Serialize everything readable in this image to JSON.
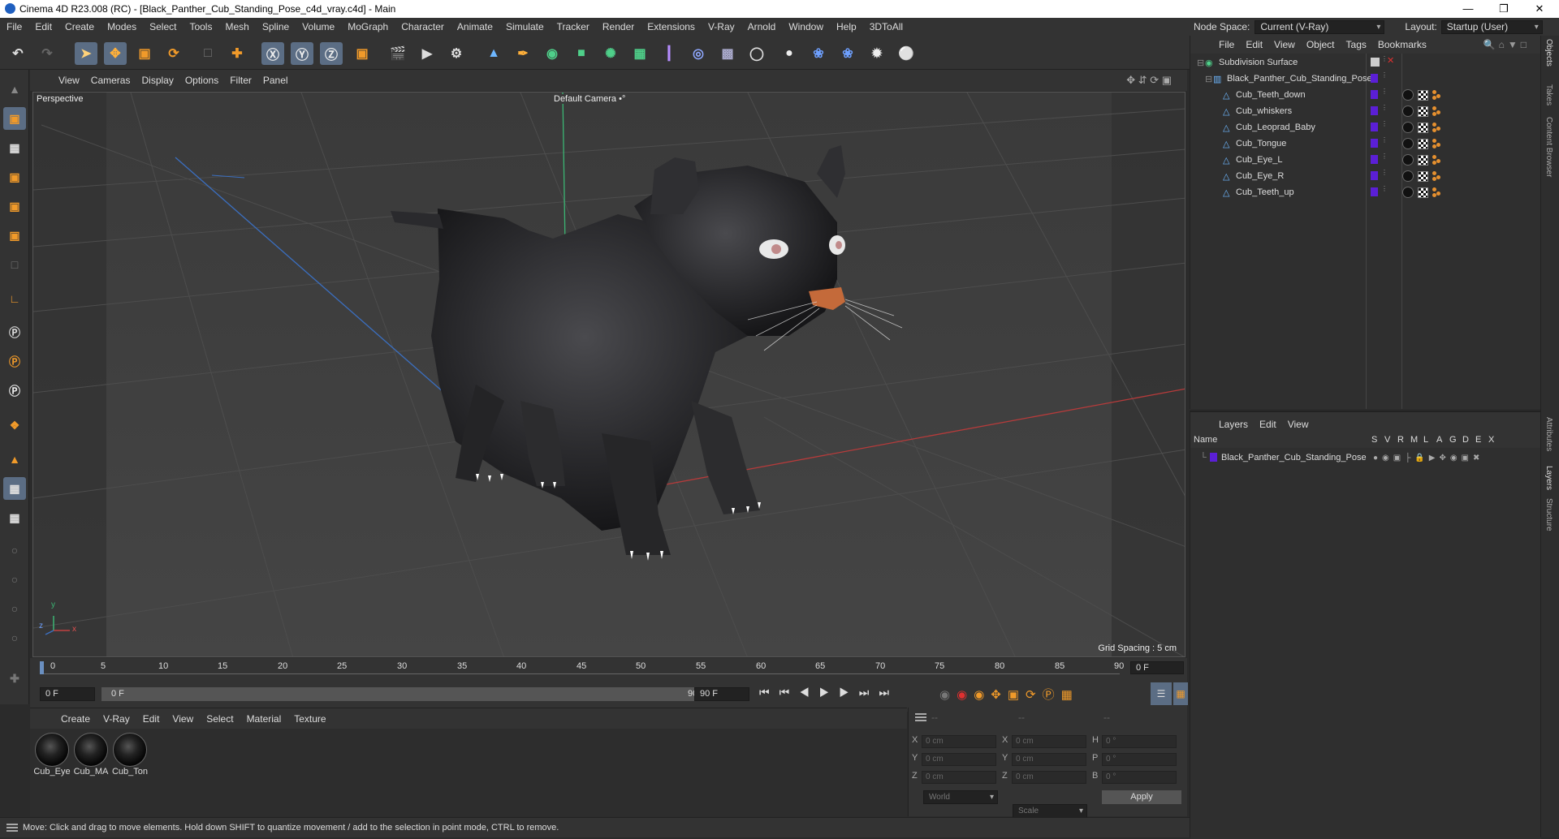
{
  "window": {
    "title": "Cinema 4D R23.008 (RC) - [Black_Panther_Cub_Standing_Pose_c4d_vray.c4d] - Main",
    "minimize": "—",
    "maximize": "❐",
    "close": "✕"
  },
  "menu": [
    "File",
    "Edit",
    "Create",
    "Modes",
    "Select",
    "Tools",
    "Mesh",
    "Spline",
    "Volume",
    "MoGraph",
    "Character",
    "Animate",
    "Simulate",
    "Tracker",
    "Render",
    "Extensions",
    "V-Ray",
    "Arnold",
    "Window",
    "Help",
    "3DToAll"
  ],
  "nodespace": {
    "label": "Node Space:",
    "value": "Current (V-Ray)",
    "layout_label": "Layout:",
    "layout_value": "Startup (User)"
  },
  "viewport": {
    "menu": [
      "View",
      "Cameras",
      "Display",
      "Options",
      "Filter",
      "Panel"
    ],
    "name": "Perspective",
    "camera": "Default Camera •°",
    "grid_spacing": "Grid Spacing : 5 cm",
    "axis_y": "y",
    "axis_z": "z",
    "axis_x": "x"
  },
  "timeline": {
    "ticks": [
      "0",
      "5",
      "10",
      "15",
      "20",
      "25",
      "30",
      "35",
      "40",
      "45",
      "50",
      "55",
      "60",
      "65",
      "70",
      "75",
      "80",
      "85",
      "90"
    ],
    "current_frame_right": "0 F",
    "start_field": "0 F",
    "range_start": "0 F",
    "range_end": "90 F",
    "end_field": "90 F"
  },
  "materials": {
    "menu": [
      "Create",
      "V-Ray",
      "Edit",
      "View",
      "Select",
      "Material",
      "Texture"
    ],
    "items": [
      "Cub_Eye",
      "Cub_MA",
      "Cub_Ton"
    ]
  },
  "coords": {
    "header": [
      "--",
      "--",
      "--"
    ],
    "rows": [
      {
        "a": "X",
        "av": "0 cm",
        "b": "X",
        "bv": "0 cm",
        "c": "H",
        "cv": "0 °"
      },
      {
        "a": "Y",
        "av": "0 cm",
        "b": "Y",
        "bv": "0 cm",
        "c": "P",
        "cv": "0 °"
      },
      {
        "a": "Z",
        "av": "0 cm",
        "b": "Z",
        "bv": "0 cm",
        "c": "B",
        "cv": "0 °"
      }
    ],
    "world": "World",
    "scale": "Scale",
    "apply": "Apply"
  },
  "status": "Move: Click and drag to move elements. Hold down SHIFT to quantize movement / add to the selection in point mode, CTRL to remove.",
  "objects": {
    "menu": [
      "File",
      "Edit",
      "View",
      "Object",
      "Tags",
      "Bookmarks"
    ],
    "items": [
      {
        "name": "Subdivision Surface",
        "level": 0
      },
      {
        "name": "Black_Panther_Cub_Standing_Pose",
        "level": 1
      },
      {
        "name": "Cub_Teeth_down",
        "level": 2
      },
      {
        "name": "Cub_whiskers",
        "level": 2
      },
      {
        "name": "Cub_Leoprad_Baby",
        "level": 2
      },
      {
        "name": "Cub_Tongue",
        "level": 2
      },
      {
        "name": "Cub_Eye_L",
        "level": 2
      },
      {
        "name": "Cub_Eye_R",
        "level": 2
      },
      {
        "name": "Cub_Teeth_up",
        "level": 2
      }
    ]
  },
  "layers": {
    "menu": [
      "Layers",
      "Edit",
      "View"
    ],
    "columns": [
      "Name",
      "S",
      "V",
      "R",
      "M",
      "L",
      "A",
      "G",
      "D",
      "E",
      "X"
    ],
    "items": [
      {
        "name": "Black_Panther_Cub_Standing_Pose",
        "color": "#5b1fd6"
      }
    ]
  },
  "side_tabs": [
    "Objects",
    "Takes",
    "Content Browser",
    "Attributes",
    "Layers",
    "Structure"
  ],
  "accent": "#5b6d84"
}
